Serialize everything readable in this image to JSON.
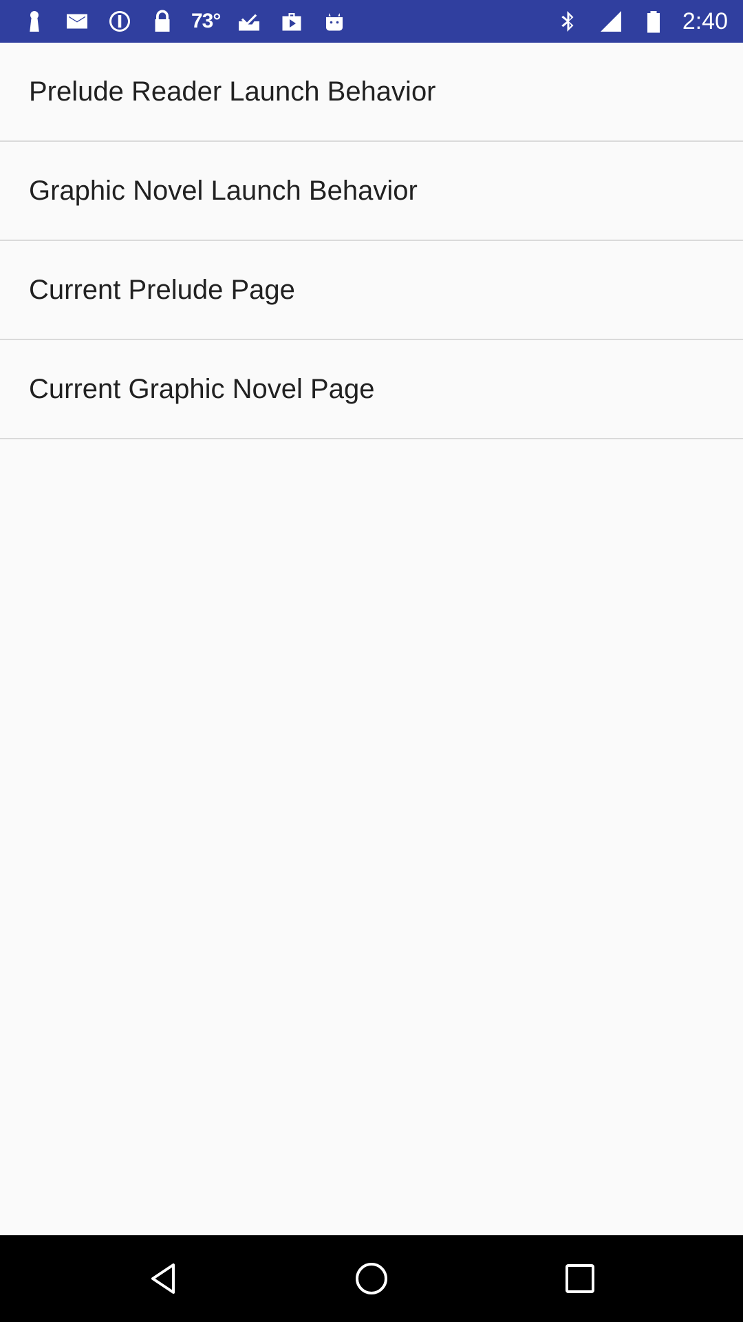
{
  "status_bar": {
    "left_icons": [
      "keyhole-icon",
      "mail-icon",
      "info-icon",
      "lock-icon"
    ],
    "temperature": "73°",
    "more_icons": [
      "tray-check-icon",
      "play-bag-icon",
      "android-icon"
    ],
    "right_icons": [
      "bluetooth-icon",
      "signal-icon",
      "battery-icon"
    ],
    "time": "2:40",
    "background_color": "#303F9F"
  },
  "settings": {
    "items": [
      {
        "label": "Prelude Reader Launch Behavior"
      },
      {
        "label": "Graphic Novel Launch Behavior"
      },
      {
        "label": "Current Prelude Page"
      },
      {
        "label": "Current Graphic Novel Page"
      }
    ]
  },
  "nav_bar": {
    "buttons": [
      "back-icon",
      "home-icon",
      "recents-icon"
    ],
    "background_color": "#000000"
  }
}
